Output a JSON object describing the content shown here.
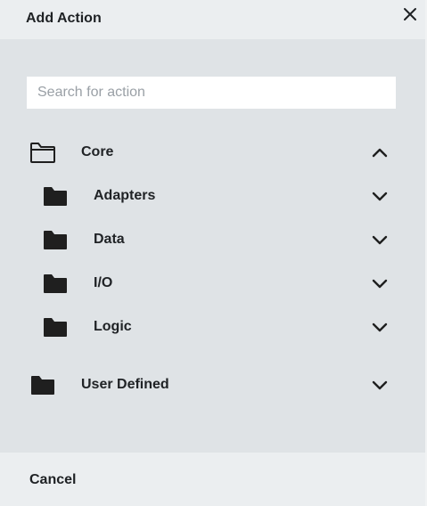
{
  "dialog": {
    "title": "Add Action",
    "close_icon": "close-icon"
  },
  "search": {
    "placeholder": "Search for action",
    "value": ""
  },
  "tree": {
    "core": {
      "label": "Core",
      "icon": "folder-open-icon",
      "expanded": true,
      "children": [
        {
          "label": "Adapters",
          "icon": "folder-icon",
          "expanded": false
        },
        {
          "label": "Data",
          "icon": "folder-icon",
          "expanded": false
        },
        {
          "label": "I/O",
          "icon": "folder-icon",
          "expanded": false
        },
        {
          "label": "Logic",
          "icon": "folder-icon",
          "expanded": false
        }
      ]
    },
    "user_defined": {
      "label": "User Defined",
      "icon": "folder-icon",
      "expanded": false
    }
  },
  "footer": {
    "cancel_label": "Cancel"
  },
  "colors": {
    "body_bg": "#dfe3e6",
    "header_bg": "#ebeef0",
    "text": "#202326",
    "icon": "#1f1f1f"
  }
}
